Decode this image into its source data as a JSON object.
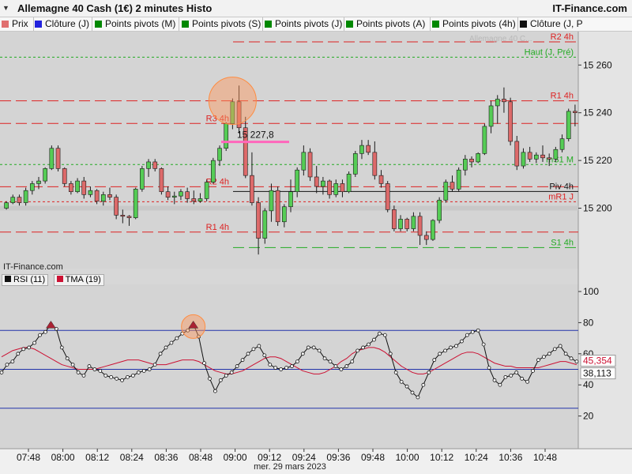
{
  "header": {
    "title": "Allemagne 40 Cash (1€) 2 minutes Histo",
    "brand": "IT-Finance.com",
    "dropdown_icon": "caret-down-icon"
  },
  "legend": [
    {
      "label": "Prix",
      "color": "#e07070"
    },
    {
      "label": "Clôture (J)",
      "color": "#2222dd"
    },
    {
      "label": "Points pivots (M)",
      "color": "#008800"
    },
    {
      "label": "Points pivots (S)",
      "color": "#008800"
    },
    {
      "label": "Points pivots (J)",
      "color": "#008800"
    },
    {
      "label": "Points pivots (A)",
      "color": "#008800"
    },
    {
      "label": "Points pivots (4h)",
      "color": "#008800"
    },
    {
      "label": "Clôture (J, P",
      "color": "#111111"
    }
  ],
  "watermark": "IT-Finance.com",
  "faint_overlay_text": "Allemagne 40 C...",
  "price_levels": [
    {
      "label": "R2 4h",
      "value": 15269.7,
      "color": "#dd2222",
      "style": "long-dash"
    },
    {
      "label": "Haut (J, Pré)",
      "value": 15263.3,
      "color": "#22aa22",
      "style": "short-dash"
    },
    {
      "label": "R1 4h",
      "value": 15245.0,
      "color": "#dd2222",
      "style": "long-dash"
    },
    {
      "label": "R3 4h",
      "value": 15235.5,
      "color": "#dd2222",
      "style": "long-dash"
    },
    {
      "label": "mS1 M",
      "value": 15218.3,
      "color": "#22aa22",
      "style": "short-dash"
    },
    {
      "label": "R2 4h",
      "value": 15209.0,
      "color": "#dd2222",
      "style": "long-dash"
    },
    {
      "label": "Piv 4h",
      "value": 15207.0,
      "color": "#111111",
      "style": "solid"
    },
    {
      "label": "mR1 J",
      "value": 15202.7,
      "color": "#dd2222",
      "style": "short-dash"
    },
    {
      "label": "R1 4h",
      "value": 15190.0,
      "color": "#dd2222",
      "style": "long-dash"
    },
    {
      "label": "S1 4h",
      "value": 15183.5,
      "color": "#22aa22",
      "style": "long-dash"
    }
  ],
  "annotation": {
    "text": "15 227,8",
    "value": 15227.8
  },
  "chart_data": [
    {
      "type": "candlestick",
      "title": "Allemagne 40 Cash (1€) 2 minutes Histo",
      "x_tick_labels": [
        "07:48",
        "08:00",
        "08:12",
        "08:24",
        "08:36",
        "08:48",
        "09:00",
        "09:12",
        "09:24",
        "09:36",
        "09:48",
        "10:00",
        "10:12",
        "10:24",
        "10:36",
        "10:48"
      ],
      "x_date_label": "mer. 29 mars 2023",
      "y_tick_labels": [
        "15 200",
        "15 220",
        "15 240",
        "15 260"
      ],
      "ylim": [
        15178,
        15274
      ],
      "y_ticks": [
        15200,
        15220,
        15240,
        15260
      ],
      "grid": false,
      "series": [
        {
          "name": "Prix",
          "up_color": "#55cc55",
          "down_color": "#dd6a6a",
          "ohlc": [
            [
              15200,
              15202.9,
              15199.4,
              15202.3
            ],
            [
              15202.3,
              15205.7,
              15201.7,
              15204.6
            ],
            [
              15204.6,
              15205.7,
              15201.1,
              15202.3
            ],
            [
              15202.3,
              15208.6,
              15201.1,
              15207.4
            ],
            [
              15207.4,
              15211.4,
              15205.7,
              15210.3
            ],
            [
              15210.3,
              15213.1,
              15208,
              15211.4
            ],
            [
              15211.4,
              15217.1,
              15210.3,
              15216.6
            ],
            [
              15216.6,
              15226.3,
              15216,
              15225.1
            ],
            [
              15225.1,
              15226.3,
              15215.4,
              15216.6
            ],
            [
              15216.6,
              15217.1,
              15209.1,
              15210.3
            ],
            [
              15210.3,
              15211.4,
              15205.7,
              15206.9
            ],
            [
              15206.9,
              15212.6,
              15206.3,
              15211.4
            ],
            [
              15211.4,
              15213.1,
              15204,
              15205.7
            ],
            [
              15205.7,
              15209.1,
              15204.6,
              15207.4
            ],
            [
              15207.4,
              15208,
              15201.7,
              15202.9
            ],
            [
              15202.9,
              15206.9,
              15201.1,
              15205.7
            ],
            [
              15205.7,
              15208.6,
              15203.4,
              15204.6
            ],
            [
              15204.6,
              15205.7,
              15195.4,
              15197.1
            ],
            [
              15197.1,
              15199.4,
              15193.7,
              15196.6
            ],
            [
              15196.6,
              15197.1,
              15192.6,
              15196
            ],
            [
              15196,
              15208.6,
              15195.4,
              15208
            ],
            [
              15208,
              15217.7,
              15206.9,
              15216.6
            ],
            [
              15216.6,
              15220.6,
              15213.1,
              15219.4
            ],
            [
              15219.4,
              15220.6,
              15215.4,
              15216.6
            ],
            [
              15216.6,
              15217.1,
              15205.7,
              15206.9
            ],
            [
              15206.9,
              15209.1,
              15203.4,
              15204.6
            ],
            [
              15204.6,
              15206.9,
              15201.7,
              15205.1
            ],
            [
              15205.1,
              15208,
              15203.4,
              15206.9
            ],
            [
              15206.9,
              15208.6,
              15202.3,
              15204
            ],
            [
              15204,
              15207.4,
              15201.7,
              15202.9
            ],
            [
              15202.9,
              15206.3,
              15202.3,
              15204
            ],
            [
              15204,
              15212,
              15202.9,
              15210.9
            ],
            [
              15210.9,
              15221.1,
              15210.3,
              15220
            ],
            [
              15220,
              15226.3,
              15217.7,
              15225.1
            ],
            [
              15225.1,
              15236,
              15224,
              15235.4
            ],
            [
              15235.4,
              15246,
              15233.1,
              15244.6
            ],
            [
              15244.6,
              15251.4,
              15231.4,
              15233.7
            ],
            [
              15233.7,
              15238.3,
              15212.6,
              15213.7
            ],
            [
              15213.7,
              15223.4,
              15201.1,
              15202.3
            ],
            [
              15202.3,
              15204.6,
              15180.6,
              15187.4
            ],
            [
              15187.4,
              15200,
              15185.1,
              15198.9
            ],
            [
              15198.9,
              15210.3,
              15194.3,
              15207.4
            ],
            [
              15207.4,
              15209.1,
              15192.6,
              15194.3
            ],
            [
              15194.3,
              15201.7,
              15192,
              15200.6
            ],
            [
              15200.6,
              15212,
              15198.3,
              15206.9
            ],
            [
              15206.9,
              15217.1,
              15204.6,
              15216
            ],
            [
              15216,
              15226.3,
              15213.7,
              15223.4
            ],
            [
              15223.4,
              15225.1,
              15211.4,
              15213.1
            ],
            [
              15213.1,
              15217.7,
              15206.3,
              15209.1
            ],
            [
              15209.1,
              15213.1,
              15205.7,
              15211.4
            ],
            [
              15211.4,
              15212,
              15204,
              15205.7
            ],
            [
              15205.7,
              15212,
              15204.6,
              15210.3
            ],
            [
              15210.3,
              15212,
              15204.6,
              15206.9
            ],
            [
              15206.9,
              15215.4,
              15206.3,
              15214.3
            ],
            [
              15214.3,
              15224,
              15213.1,
              15222.9
            ],
            [
              15222.9,
              15228.6,
              15220.6,
              15226.3
            ],
            [
              15226.3,
              15228.6,
              15222.3,
              15223.4
            ],
            [
              15223.4,
              15228,
              15212,
              15213.7
            ],
            [
              15213.7,
              15216,
              15208.6,
              15210.3
            ],
            [
              15210.3,
              15211.4,
              15198.3,
              15199.4
            ],
            [
              15199.4,
              15201.1,
              15190.3,
              15191.4
            ],
            [
              15191.4,
              15197.1,
              15190.3,
              15195.4
            ],
            [
              15195.4,
              15196,
              15190.3,
              15191.4
            ],
            [
              15191.4,
              15198.3,
              15190.3,
              15196.6
            ],
            [
              15196.6,
              15198.3,
              15184.6,
              15188.6
            ],
            [
              15188.6,
              15190.3,
              15184.6,
              15186.9
            ],
            [
              15186.9,
              15195.4,
              15186.3,
              15194.9
            ],
            [
              15194.9,
              15204.6,
              15193.7,
              15203.4
            ],
            [
              15203.4,
              15212,
              15202.3,
              15210.9
            ],
            [
              15210.9,
              15213.7,
              15206.9,
              15208
            ],
            [
              15208,
              15217.1,
              15206.9,
              15216
            ],
            [
              15216,
              15222.3,
              15213.7,
              15220.6
            ],
            [
              15220.6,
              15221.7,
              15217.1,
              15219.4
            ],
            [
              15219.4,
              15223.4,
              15218.9,
              15222.9
            ],
            [
              15222.9,
              15235.4,
              15222.3,
              15234.3
            ],
            [
              15234.3,
              15245,
              15231.4,
              15242.9
            ],
            [
              15242.9,
              15247.4,
              15235.4,
              15245.7
            ],
            [
              15245.7,
              15250.6,
              15240,
              15244.6
            ],
            [
              15244.6,
              15246.3,
              15226.3,
              15228
            ],
            [
              15228,
              15230.3,
              15216,
              15217.7
            ],
            [
              15217.7,
              15225.1,
              15216.6,
              15223.4
            ],
            [
              15223.4,
              15225.7,
              15219.4,
              15220.6
            ],
            [
              15220.6,
              15223.4,
              15218.9,
              15222.3
            ],
            [
              15222.3,
              15226.3,
              15219.4,
              15221.1
            ],
            [
              15221.1,
              15222.9,
              15217.7,
              15220.6
            ],
            [
              15220.6,
              15225.7,
              15219.4,
              15224.6
            ],
            [
              15224.6,
              15230.9,
              15223.4,
              15229.1
            ],
            [
              15229.1,
              15241.7,
              15228,
              15240.6
            ],
            [
              15240.6,
              15243.4,
              15234.3,
              15240
            ]
          ]
        }
      ]
    },
    {
      "type": "line",
      "title": "",
      "y_tick_labels": [
        "20",
        "40",
        "60",
        "80",
        "100"
      ],
      "ylim": [
        0,
        100
      ],
      "y_ticks": [
        20,
        40,
        60,
        80,
        100
      ],
      "reference_lines": [
        75,
        50,
        25
      ],
      "series": [
        {
          "name": "RSI (11)",
          "color": "#111111",
          "last_value_label": "38,113",
          "values": [
            48,
            53,
            55,
            60,
            63,
            64,
            67,
            72,
            74,
            79,
            76,
            64,
            57,
            53,
            48,
            46,
            52,
            50,
            49,
            46,
            45,
            44,
            43,
            45,
            46,
            48,
            49,
            50,
            53,
            60,
            64,
            67,
            70,
            73,
            75,
            79,
            71,
            54,
            44,
            36,
            43,
            46,
            48,
            52,
            56,
            60,
            63,
            65,
            59,
            53,
            51,
            50,
            51,
            52,
            55,
            60,
            64,
            64,
            62,
            57,
            55,
            52,
            50,
            52,
            55,
            62,
            64,
            66,
            69,
            73,
            72,
            60,
            48,
            42,
            39,
            35,
            32,
            40,
            48,
            56,
            60,
            62,
            64,
            65,
            68,
            72,
            74,
            75,
            66,
            51,
            43,
            40,
            45,
            46,
            48,
            44,
            42,
            49,
            56,
            58,
            60,
            63,
            65,
            60,
            57,
            55
          ]
        },
        {
          "name": "TMA (19)",
          "color": "#cc1133",
          "last_value_label": "45,354",
          "values": [
            58,
            60,
            62,
            63,
            64,
            64,
            63,
            61,
            59,
            57,
            55,
            53,
            52,
            51,
            50,
            50,
            50,
            50,
            51,
            52,
            53,
            54,
            55,
            56,
            56,
            56,
            55,
            54,
            53,
            53,
            53,
            54,
            55,
            56,
            56,
            56,
            55,
            53,
            51,
            49,
            48,
            47,
            47,
            48,
            49,
            51,
            53,
            55,
            57,
            58,
            58,
            57,
            55,
            53,
            51,
            49,
            48,
            47,
            47,
            48,
            50,
            52,
            55,
            57,
            60,
            62,
            63,
            64,
            64,
            63,
            61,
            58,
            55,
            52,
            50,
            48,
            47,
            47,
            48,
            50,
            52,
            54,
            56,
            58,
            60,
            61,
            61,
            60,
            58,
            56,
            54,
            53,
            52,
            52,
            51,
            51,
            51,
            51,
            51,
            52,
            53,
            54,
            55,
            55,
            54,
            53
          ]
        }
      ]
    }
  ]
}
